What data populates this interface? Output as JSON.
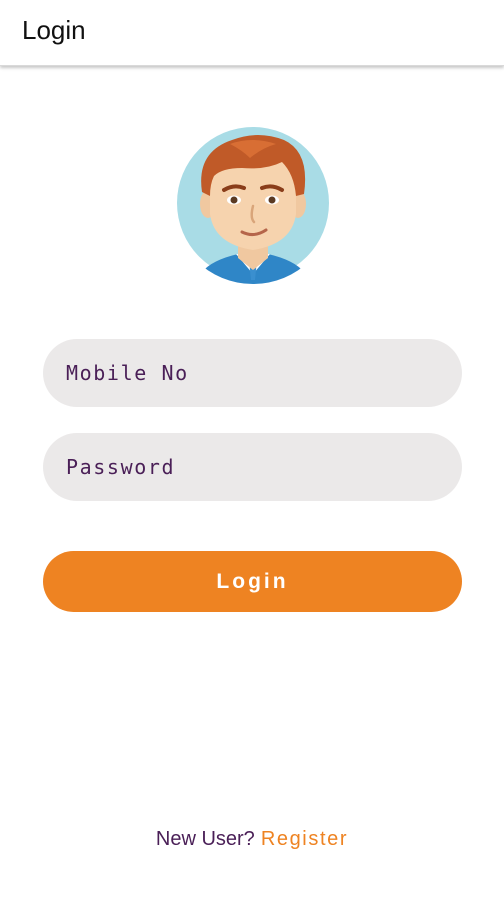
{
  "app_bar": {
    "title": "Login"
  },
  "avatar": {
    "icon": "avatar-icon"
  },
  "form": {
    "mobile": {
      "placeholder": "Mobile No",
      "value": ""
    },
    "password": {
      "placeholder": "Password",
      "value": ""
    },
    "login_label": "Login"
  },
  "footer": {
    "question": "New User?",
    "register_label": "Register"
  },
  "colors": {
    "accent": "#ee8322",
    "field_bg": "#ebe9e9",
    "text_purple": "#4a1f57",
    "avatar_bg": "#a9dce6"
  }
}
